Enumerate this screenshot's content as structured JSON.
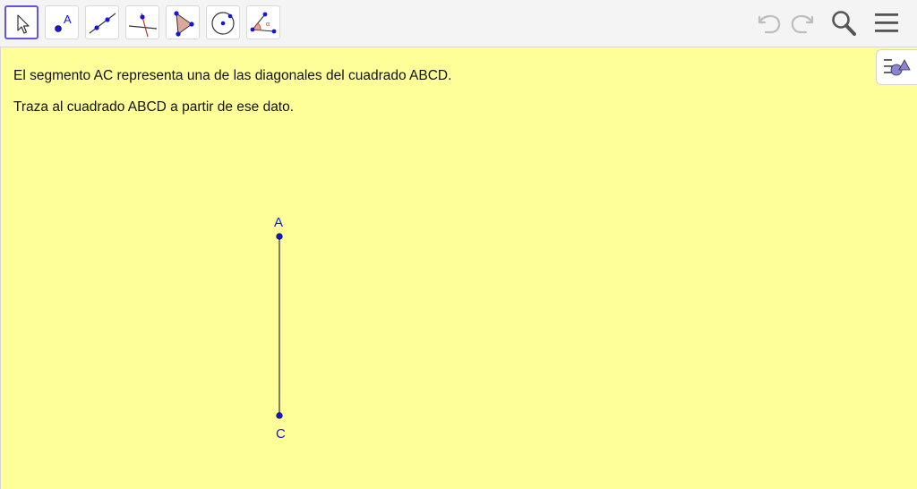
{
  "toolbar": {
    "tools": [
      {
        "name": "move-tool",
        "icon": "arrow-pointer-icon",
        "selected": true
      },
      {
        "name": "point-tool",
        "icon": "point-icon",
        "selected": false
      },
      {
        "name": "line-tool",
        "icon": "line-icon",
        "selected": false
      },
      {
        "name": "perpendicular-line-tool",
        "icon": "perpendicular-line-icon",
        "selected": false
      },
      {
        "name": "polygon-tool",
        "icon": "polygon-icon",
        "selected": false
      },
      {
        "name": "circle-tool",
        "icon": "circle-with-center-icon",
        "selected": false
      },
      {
        "name": "angle-tool",
        "icon": "angle-icon",
        "selected": false
      }
    ],
    "point_tool_letter": "A",
    "right_icons": [
      "undo-icon",
      "redo-icon",
      "search-icon",
      "menu-icon"
    ],
    "angle_tool_glyph": "α"
  },
  "instructions": {
    "line1": "El segmento AC representa una de las diagonales del cuadrado ABCD.",
    "line2": "Traza al cuadrado ABCD a partir de ese dato."
  },
  "construction": {
    "points": [
      {
        "label": "A"
      },
      {
        "label": "C"
      }
    ],
    "segment": "AC"
  },
  "side_panel": {
    "icon": "algebra-view-toggle-icon"
  },
  "colors": {
    "canvas_background": "#ffff99",
    "toolbar_background": "#f4f4f4",
    "selected_tool_border": "#6557d2",
    "point_color": "#1414e6",
    "segment_color": "#555555"
  }
}
